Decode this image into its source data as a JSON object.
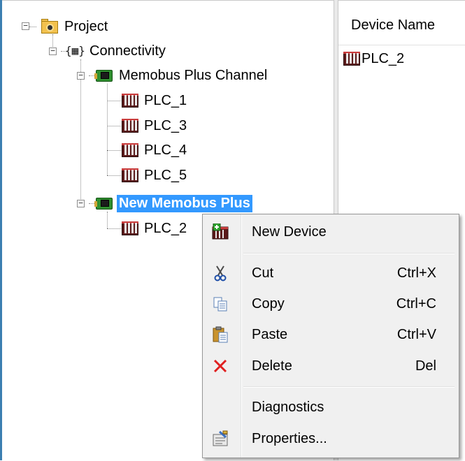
{
  "tree": {
    "project": "Project",
    "connectivity": "Connectivity",
    "channel1": "Memobus Plus Channel",
    "channel1_devices": [
      "PLC_1",
      "PLC_3",
      "PLC_4",
      "PLC_5"
    ],
    "channel2": "New Memobus Plus",
    "channel2_devices": [
      "PLC_2"
    ]
  },
  "list": {
    "column_header": "Device Name",
    "rows": [
      "PLC_2"
    ]
  },
  "context_menu": {
    "new_device": "New Device",
    "cut": "Cut",
    "cut_shortcut": "Ctrl+X",
    "copy": "Copy",
    "copy_shortcut": "Ctrl+C",
    "paste": "Paste",
    "paste_shortcut": "Ctrl+V",
    "delete": "Delete",
    "delete_shortcut": "Del",
    "diagnostics": "Diagnostics",
    "properties": "Properties..."
  },
  "colors": {
    "selection": "#3399ff",
    "delete_icon": "#e02020"
  }
}
